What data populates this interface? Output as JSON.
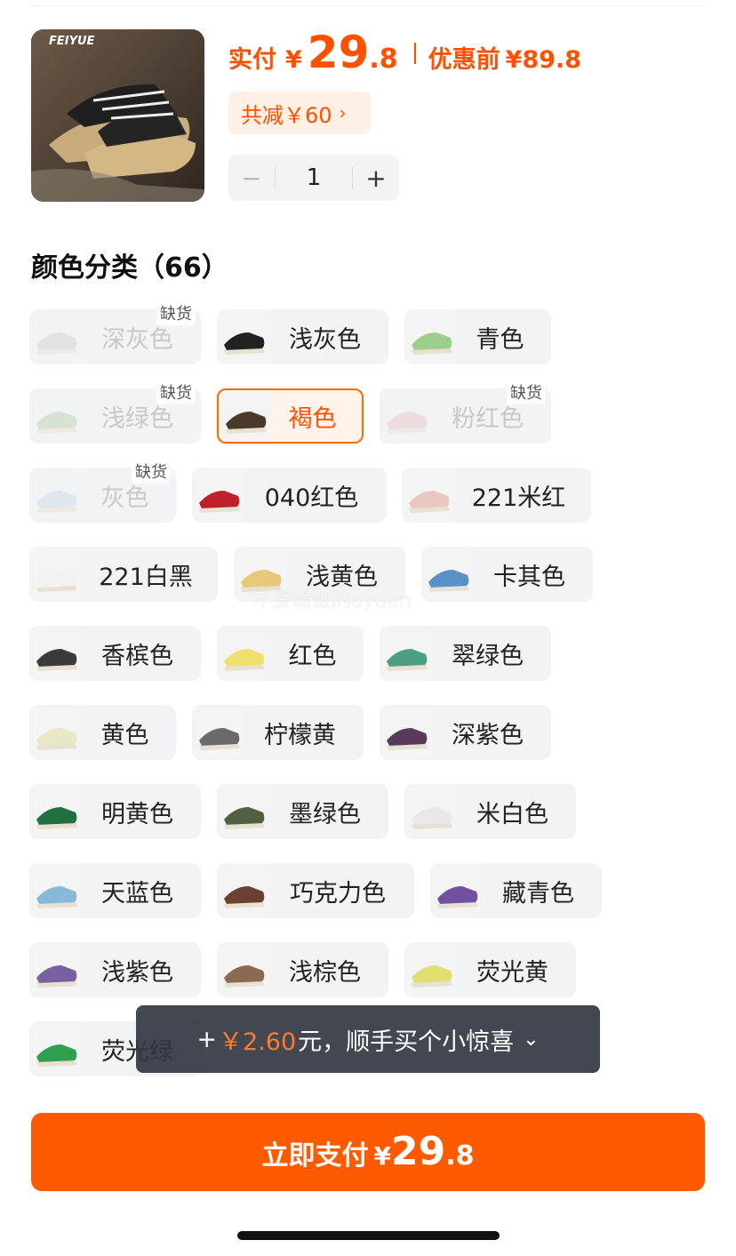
{
  "header": {
    "brand_logo_text": "FEIYUE",
    "price_label": "实付",
    "currency": "¥",
    "price_int": "29",
    "price_dec": ".8",
    "orig_label": "优惠前",
    "orig_value": "¥89.8",
    "discount_text": "共减￥60",
    "discount_chevron": "›",
    "quantity": "1",
    "minus": "−",
    "plus": "+"
  },
  "section": {
    "title": "颜色分类（66）"
  },
  "badge_text": "缺货",
  "variants": [
    {
      "label": "深灰色",
      "disabled": true,
      "badge": true
    },
    {
      "label": "浅灰色"
    },
    {
      "label": "青色"
    },
    {
      "label": "浅绿色",
      "disabled": true,
      "badge": true
    },
    {
      "label": "褐色",
      "selected": true
    },
    {
      "label": "粉红色",
      "disabled": true,
      "badge": true
    },
    {
      "label": "灰色",
      "disabled": true,
      "badge": true
    },
    {
      "label": "040红色"
    },
    {
      "label": "221米红"
    },
    {
      "label": "221白黑"
    },
    {
      "label": "浅黄色"
    },
    {
      "label": "卡其色"
    },
    {
      "label": "香槟色"
    },
    {
      "label": "红色"
    },
    {
      "label": "翠绿色"
    },
    {
      "label": "黄色"
    },
    {
      "label": "柠檬黄"
    },
    {
      "label": "深紫色"
    },
    {
      "label": "明黄色"
    },
    {
      "label": "墨绿色"
    },
    {
      "label": "米白色"
    },
    {
      "label": "天蓝色"
    },
    {
      "label": "巧克力色"
    },
    {
      "label": "藏青色"
    },
    {
      "label": "浅紫色"
    },
    {
      "label": "浅棕色"
    },
    {
      "label": "荧光黄"
    },
    {
      "label": "荧光绿"
    }
  ],
  "watermark": "不爱做饭的ayuan",
  "toast": {
    "prefix": "+",
    "amount": "￥2.60",
    "suffix": "元，顺手买个小惊喜",
    "chevron": "⌄"
  },
  "pay_button": {
    "label": "立即支付",
    "currency": "¥",
    "int": "29",
    "dec": ".8"
  },
  "colors": {
    "accent": "#ff5a00",
    "chip_bg": "#f2f3f5",
    "selected_bg": "#fff3ea"
  }
}
